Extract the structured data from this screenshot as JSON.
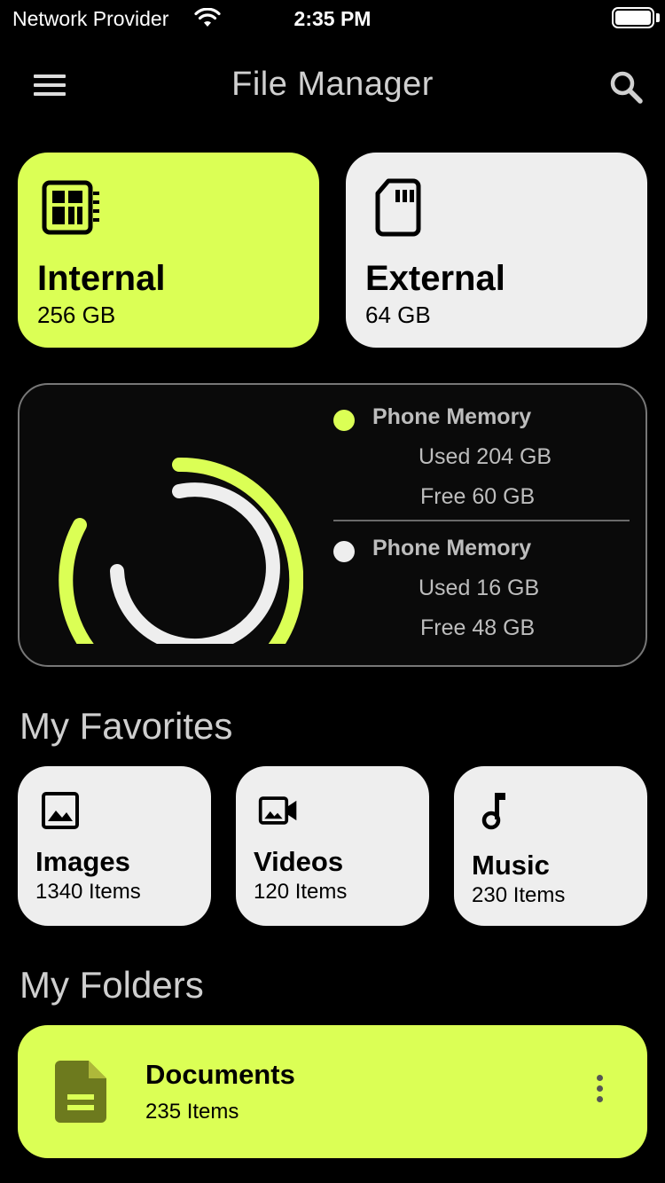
{
  "status_bar": {
    "carrier": "Network Provider",
    "time": "2:35 PM",
    "wifi_icon": "wifi-icon",
    "battery_icon": "battery-icon"
  },
  "app_bar": {
    "title": "File Manager",
    "menu_icon": "hamburger-menu-icon",
    "search_icon": "search-icon"
  },
  "colors": {
    "accent": "#dbff55",
    "card_light": "#eeeeee",
    "background": "#000000"
  },
  "storage": [
    {
      "name": "Internal",
      "size": "256 GB",
      "icon": "memory-chip-icon"
    },
    {
      "name": "External",
      "size": "64 GB",
      "icon": "sd-card-icon"
    }
  ],
  "memory": {
    "entries": [
      {
        "label": "Phone Memory",
        "used": "Used 204 GB",
        "free": "Free 60 GB",
        "color": "#dbff55"
      },
      {
        "label": "Phone Memory",
        "used": "Used 16 GB",
        "free": "Free 48 GB",
        "color": "#eeeeee"
      }
    ]
  },
  "favorites": {
    "title": "My Favorites",
    "items": [
      {
        "name": "Images",
        "count": "1340 Items",
        "icon": "image-icon"
      },
      {
        "name": "Videos",
        "count": "120 Items",
        "icon": "video-camera-icon"
      },
      {
        "name": "Music",
        "count": "230 Items",
        "icon": "music-note-icon"
      }
    ]
  },
  "folders": {
    "title": "My Folders",
    "items": [
      {
        "name": "Documents",
        "count": "235 Items",
        "icon": "document-icon",
        "menu_icon": "more-vertical-icon"
      }
    ]
  }
}
